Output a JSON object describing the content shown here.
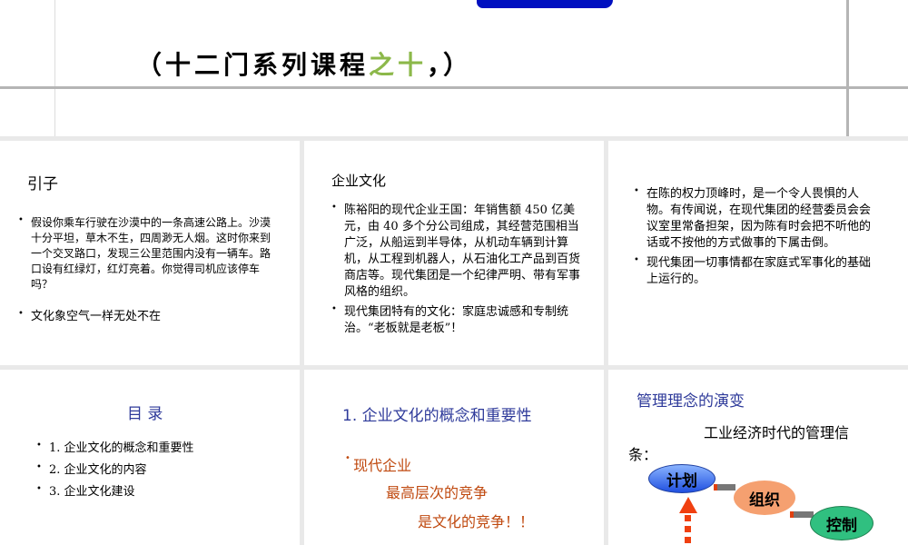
{
  "top_slide": {
    "subtitle_a": "（十二门系列课程",
    "subtitle_b": "之十",
    "subtitle_c": "，）"
  },
  "slide1": {
    "title": "引子",
    "bullets": [
      "假设你乘车行驶在沙漠中的一条高速公路上。沙漠十分平坦，草木不生，四周渺无人烟。这时你来到一个交叉路口，发现三公里范围内没有一辆车。路口设有红绿灯，红灯亮着。你觉得司机应该停车吗？",
      "文化象空气一样无处不在"
    ]
  },
  "slide2": {
    "title": "企业文化",
    "bullets": [
      "陈裕阳的现代企业王国：年销售额 450 亿美元，由 40 多个分公司组成，其经营范围相当广泛，从船运到半导体，从机动车辆到计算机，从工程到机器人，从石油化工产品到百货商店等。现代集团是一个纪律严明、带有军事风格的组织。",
      "现代集团特有的文化：家庭忠诚感和专制统治。“老板就是老板”！"
    ]
  },
  "slide3": {
    "bullets": [
      "在陈的权力顶峰时，是一个令人畏惧的人物。有传闻说，在现代集团的经营委员会会议室里常备担架，因为陈有时会把不听他的话或不按他的方式做事的下属击倒。",
      "现代集团一切事情都在家庭式军事化的基础上运行的。"
    ]
  },
  "slide4": {
    "title": "目 录",
    "items": [
      "1. 企业文化的概念和重要性",
      "2. 企业文化的内容",
      "3. 企业文化建设"
    ]
  },
  "slide5": {
    "title": "1. 企业文化的概念和重要性",
    "line1": "现代企业",
    "line2": "最高层次的竞争",
    "line3": "是文化的竞争！！"
  },
  "slide6": {
    "title": "管理理念的演变",
    "subtitle_a": "工业经济时代的管理信",
    "subtitle_b": "条：",
    "nodes": [
      "计划",
      "组织",
      "控制"
    ]
  }
}
